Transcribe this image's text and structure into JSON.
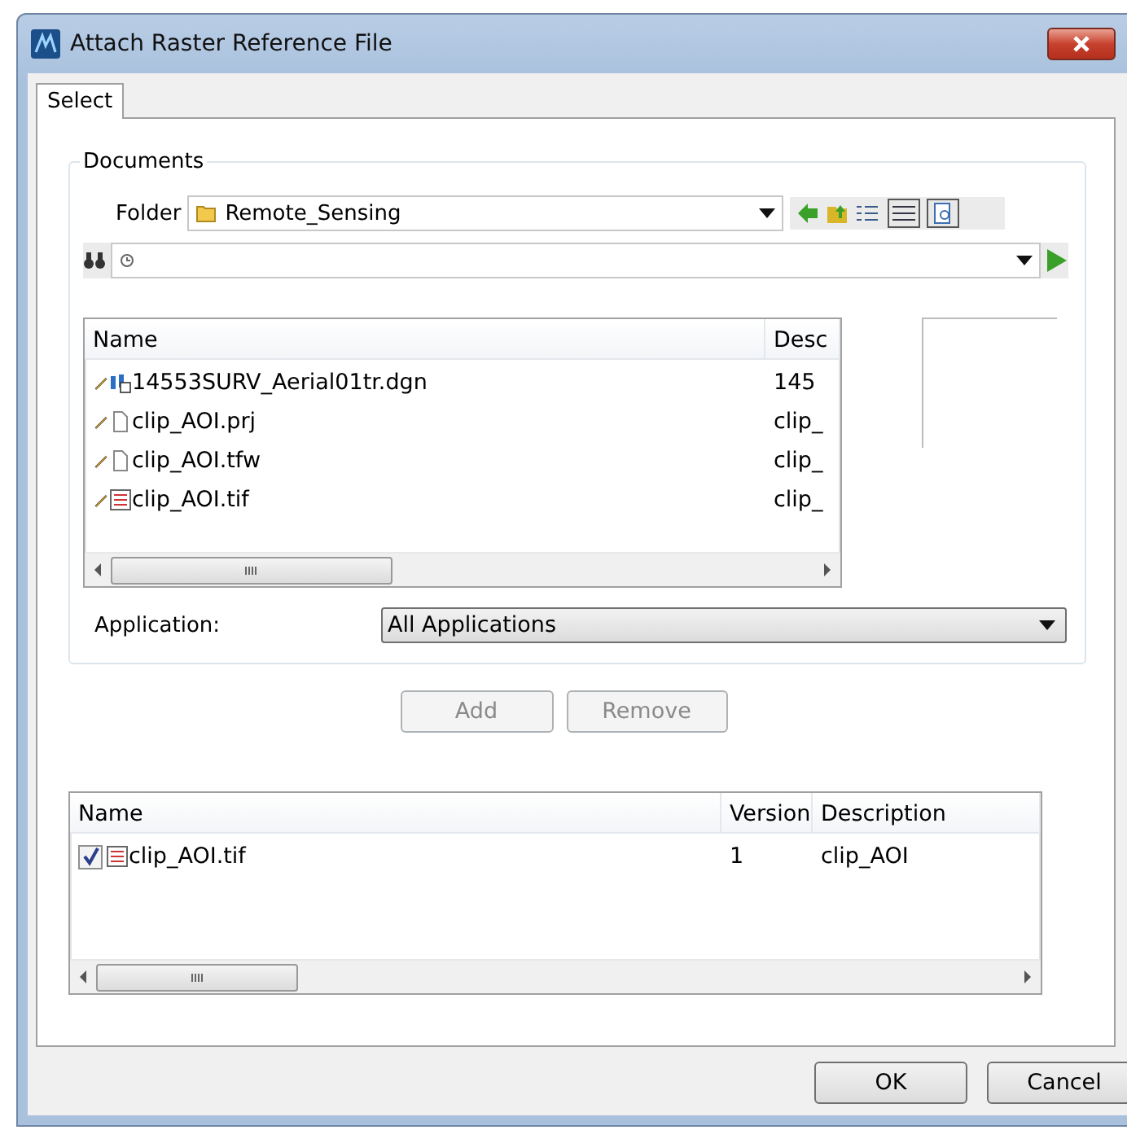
{
  "window": {
    "title": "Attach Raster Reference File"
  },
  "tabs": [
    {
      "label": "Select",
      "selected": true
    }
  ],
  "documents": {
    "title": "Documents",
    "folder_label": "Folder",
    "folder": "Remote_Sensing",
    "file_list": {
      "columns": [
        "Name",
        "Desc"
      ],
      "rows": [
        {
          "name": "14553SURV_Aerial01tr.dgn",
          "description": "145",
          "kind": "design"
        },
        {
          "name": "clip_AOI.prj",
          "description": "clip_",
          "kind": "blank"
        },
        {
          "name": "clip_AOI.tfw",
          "description": "clip_",
          "kind": "blank"
        },
        {
          "name": "clip_AOI.tif",
          "description": "clip_",
          "kind": "raster"
        }
      ]
    },
    "application": {
      "label": "Application:",
      "value": "All Applications"
    }
  },
  "buttons": [
    {
      "label": "Add",
      "disabled": true
    },
    {
      "label": "Remove",
      "disabled": true
    }
  ],
  "selected_list": {
    "columns": [
      "Name",
      "Version",
      "Description"
    ],
    "rows": [
      {
        "name": "clip_AOI.tif",
        "version": "1",
        "description": "clip_AOI",
        "checked": true,
        "kind": "raster"
      }
    ]
  },
  "dialog_buttons": [
    "OK",
    "Cancel"
  ]
}
